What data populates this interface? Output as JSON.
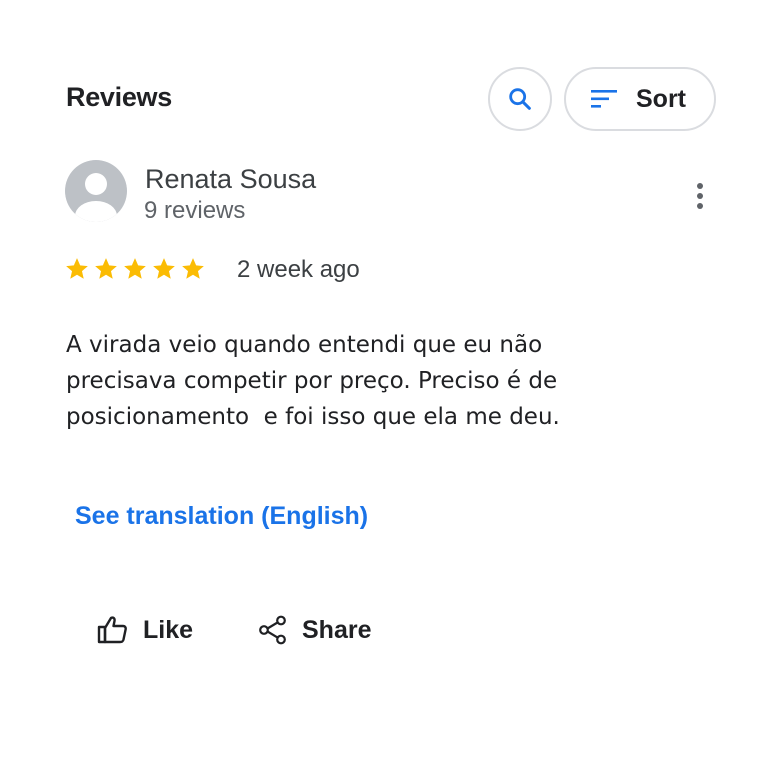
{
  "header": {
    "title": "Reviews",
    "search_icon": "search-icon",
    "sort_label": "Sort",
    "sort_icon": "sort-lines-icon"
  },
  "review": {
    "author": "Renata Sousa",
    "author_reviews": "9 reviews",
    "avatar_icon": "default-person-avatar",
    "rating": 5,
    "rating_max": 5,
    "date": "2 week ago",
    "text": "A virada veio quando entendi que eu não\nprecisava competir por preço. Preciso é de\nposicionamento  e foi isso que ela me deu.",
    "translate_label": "See translation (English)",
    "more_icon": "more-vertical-icon"
  },
  "actions": {
    "like_label": "Like",
    "like_icon": "thumbs-up-icon",
    "share_label": "Share",
    "share_icon": "share-icon"
  },
  "colors": {
    "accent": "#1a73e8",
    "star": "#fbbc04",
    "border": "#dadce0"
  }
}
